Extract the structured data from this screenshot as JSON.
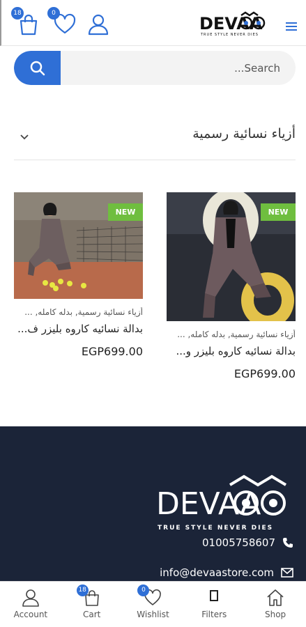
{
  "header": {
    "cart_count": "18",
    "wishlist_count": "0",
    "logo_text": "DEVAA",
    "logo_tagline": "TRUE STYLE NEVER DIES"
  },
  "search": {
    "placeholder": "Search..."
  },
  "category": {
    "title": "أزياء نسائية رسمية"
  },
  "products": [
    {
      "badge": "NEW",
      "category": "أزياء نسائية رسمية, بدله كامله, ...",
      "name": "بدالة نسائيه كاروه بليزر و...",
      "price": "EGP699.00"
    },
    {
      "badge": "NEW",
      "category": "أزياء نسائية رسمية, بدله كامله, ...",
      "name": "بدالة نسائيه كاروه بليزر ف...",
      "price": "EGP699.00"
    }
  ],
  "footer": {
    "logo_text": "DEVAA",
    "logo_tagline": "TRUE STYLE NEVER DIES",
    "phone": "01005758607",
    "email": "info@devaastore.com"
  },
  "bottom_nav": {
    "items": [
      {
        "label": "Account"
      },
      {
        "label": "Cart",
        "badge": "18"
      },
      {
        "label": "Wishlist",
        "badge": "0"
      },
      {
        "label": "Filters"
      },
      {
        "label": "Shop"
      }
    ]
  },
  "colors": {
    "accent": "#2f6fd6",
    "new_badge": "#6fbe3f",
    "footer_bg": "#1b2438"
  }
}
